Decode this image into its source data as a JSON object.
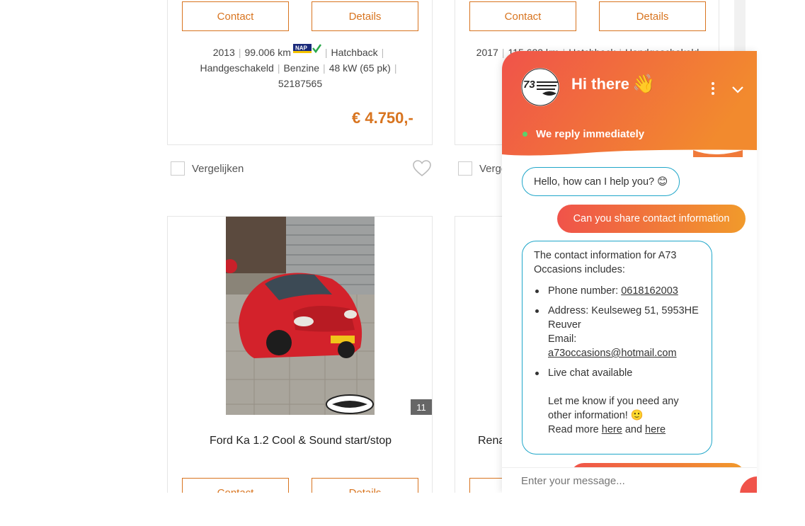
{
  "listings": [
    {
      "contact_label": "Contact",
      "details_label": "Details",
      "year": "2013",
      "mileage": "99.006 km",
      "nap_badge": "NAP",
      "body": "Hatchback",
      "transmission": "Handgeschakeld",
      "fuel": "Benzine",
      "power": "48 kW (65 pk)",
      "id": "52187565",
      "price": "€ 4.750,-",
      "compare_label": "Vergelijken"
    },
    {
      "contact_label": "Contact",
      "details_label": "Details",
      "year": "2017",
      "mileage": "115.623 km",
      "body": "Hatchback",
      "transmission": "Handgeschakeld",
      "compare_label": "Vergelijken"
    },
    {
      "title": "Ford Ka 1.2 Cool & Sound start/stop",
      "photo_count": "11",
      "contact_label": "Contact",
      "details_label": "Details"
    },
    {
      "title": "Renault"
    }
  ],
  "chat": {
    "greeting": "Hi there",
    "wave_emoji": "👋",
    "status": "We reply immediately",
    "messages": {
      "bot_hello": "Hello, how can I help you? 😊",
      "user_request": "Can you share contact information",
      "bot_intro": "The contact information for A73 Occasions includes:",
      "phone_label": "Phone number: ",
      "phone_value": "0618162003",
      "address_label": "Address: Keulseweg 51, 5953HE Reuver",
      "email_label": "Email:",
      "email_value": "a73occasions@hotmail.com",
      "live_chat": "Live chat available",
      "followup": "Let me know if you need any other information! 🙂",
      "read_more": "Read more ",
      "here_1": "here",
      "and": " and ",
      "here_2": "here"
    },
    "input_placeholder": "Enter your message..."
  },
  "colors": {
    "accent_orange": "#d8741f",
    "chat_gradient_start": "#f0534a",
    "chat_gradient_end": "#f19a2b",
    "bot_border": "#1fa6c9",
    "online": "#5bd26b"
  }
}
